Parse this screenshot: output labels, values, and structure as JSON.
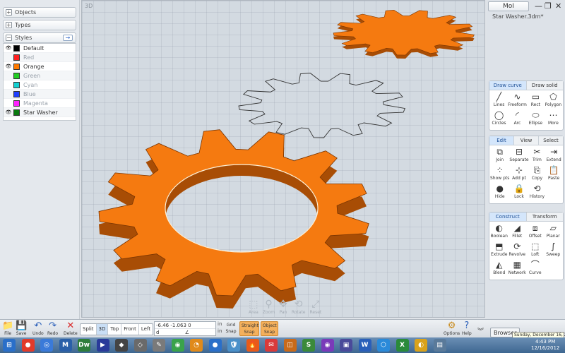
{
  "left_panel": {
    "objects_label": "Objects",
    "types_label": "Types",
    "styles_label": "Styles",
    "styles": [
      {
        "name": "Default",
        "color": "#000000",
        "visible": true,
        "dim": false
      },
      {
        "name": "Red",
        "color": "#ff2020",
        "visible": false,
        "dim": true
      },
      {
        "name": "Orange",
        "color": "#ff7a00",
        "visible": true,
        "dim": false
      },
      {
        "name": "Green",
        "color": "#22cc22",
        "visible": false,
        "dim": true
      },
      {
        "name": "Cyan",
        "color": "#14d0d0",
        "visible": false,
        "dim": true
      },
      {
        "name": "Blue",
        "color": "#2040ff",
        "visible": false,
        "dim": true
      },
      {
        "name": "Magenta",
        "color": "#ff20ff",
        "visible": false,
        "dim": true
      },
      {
        "name": "Star Washer",
        "color": "#0a7a10",
        "visible": true,
        "dim": false
      }
    ]
  },
  "viewport": {
    "label": "3D",
    "object_color": "#f57a10"
  },
  "nav_tools": [
    "Area",
    "Zoom",
    "Pan",
    "Rotate",
    "Reset"
  ],
  "right_panel": {
    "app_title": "MoI",
    "file_name": "Star Washer.3dm*",
    "draw_tabs": [
      "Draw curve",
      "Draw solid"
    ],
    "draw_cmds": [
      {
        "label": "Lines",
        "icon": "╱"
      },
      {
        "label": "Freeform",
        "icon": "∿"
      },
      {
        "label": "Rect",
        "icon": "▭"
      },
      {
        "label": "Polygon",
        "icon": "⬠"
      },
      {
        "label": "Circles",
        "icon": "◯"
      },
      {
        "label": "Arc",
        "icon": "◜"
      },
      {
        "label": "Ellipse",
        "icon": "⬭"
      },
      {
        "label": "More",
        "icon": "⋯"
      }
    ],
    "edit_tabs": [
      "Edit",
      "View",
      "Select"
    ],
    "edit_cmds": [
      {
        "label": "Join",
        "icon": "⧉"
      },
      {
        "label": "Separate",
        "icon": "⊟"
      },
      {
        "label": "Trim",
        "icon": "✂"
      },
      {
        "label": "Extend",
        "icon": "⇥"
      },
      {
        "label": "Show pts",
        "icon": "⁘"
      },
      {
        "label": "Add pt",
        "icon": "⊹"
      },
      {
        "label": "Copy",
        "icon": "⎘"
      },
      {
        "label": "Paste",
        "icon": "📋"
      },
      {
        "label": "Hide",
        "icon": "●"
      },
      {
        "label": "Lock",
        "icon": "🔒"
      },
      {
        "label": "History",
        "icon": "⟲"
      }
    ],
    "construct_tabs": [
      "Construct",
      "Transform"
    ],
    "construct_cmds": [
      {
        "label": "Boolean",
        "icon": "◐"
      },
      {
        "label": "Fillet",
        "icon": "◢"
      },
      {
        "label": "Offset",
        "icon": "⧈"
      },
      {
        "label": "Planar",
        "icon": "▱"
      },
      {
        "label": "Extrude",
        "icon": "⬒"
      },
      {
        "label": "Revolve",
        "icon": "⟳"
      },
      {
        "label": "Loft",
        "icon": "⬚"
      },
      {
        "label": "Sweep",
        "icon": "∫"
      },
      {
        "label": "Blend",
        "icon": "◭"
      },
      {
        "label": "Network",
        "icon": "▦"
      },
      {
        "label": "Curve",
        "icon": "⌒"
      }
    ]
  },
  "bottom_bar": {
    "buttons": [
      {
        "label": "File",
        "icon": "📁"
      },
      {
        "label": "Save",
        "icon": "💾"
      },
      {
        "label": "Undo",
        "icon": "↶"
      },
      {
        "label": "Redo",
        "icon": "↷"
      },
      {
        "label": "Delete",
        "icon": "✕"
      }
    ],
    "views": [
      "Split",
      "3D",
      "Top",
      "Front",
      "Left"
    ],
    "active_view": "3D",
    "coord_value": "-6.46     -1.063     0",
    "coord_d": "d",
    "coord_angle": "∠",
    "unit": "in",
    "grid_snap": "Grid Snap",
    "straight_snap": "Straight Snap",
    "object_snap": "Object Snap",
    "options_label": "Options",
    "help_label": "Help",
    "browser_label": "Browser"
  },
  "taskbar": {
    "time": "4:43 PM",
    "date": "12/16/2012",
    "date_tooltip": "Sunday, December 16, 2012",
    "apps": [
      {
        "glyph": "⊞",
        "color": "#2a6fc9"
      },
      {
        "glyph": "●",
        "color": "#e23a2a"
      },
      {
        "glyph": "◎",
        "color": "#3a7ad9"
      },
      {
        "glyph": "M",
        "color": "#2a5fa8"
      },
      {
        "glyph": "Dw",
        "color": "#2d7d3a"
      },
      {
        "glyph": "▶",
        "color": "#2a3a9a"
      },
      {
        "glyph": "◆",
        "color": "#444444"
      },
      {
        "glyph": "◇",
        "color": "#6a6a6a"
      },
      {
        "glyph": "✎",
        "color": "#7a7a7a"
      },
      {
        "glyph": "◉",
        "color": "#3aa34a"
      },
      {
        "glyph": "◔",
        "color": "#e08a1a"
      },
      {
        "glyph": "●",
        "color": "#2a6fc9"
      },
      {
        "glyph": "🛡",
        "color": "#4a90c9"
      },
      {
        "glyph": "🔥",
        "color": "#e85a1a"
      },
      {
        "glyph": "✉",
        "color": "#d93a3a"
      },
      {
        "glyph": "◫",
        "color": "#c96a1a"
      },
      {
        "glyph": "S",
        "color": "#3a8a3a"
      },
      {
        "glyph": "◉",
        "color": "#7a3ab9"
      },
      {
        "glyph": "▣",
        "color": "#4a4a9a"
      },
      {
        "glyph": "W",
        "color": "#2a5fb9"
      },
      {
        "glyph": "⬡",
        "color": "#2a8ad9"
      },
      {
        "glyph": "X",
        "color": "#2a8a3a"
      },
      {
        "glyph": "◐",
        "color": "#d9a21a"
      },
      {
        "glyph": "▤",
        "color": "#5a7a9a"
      }
    ]
  }
}
